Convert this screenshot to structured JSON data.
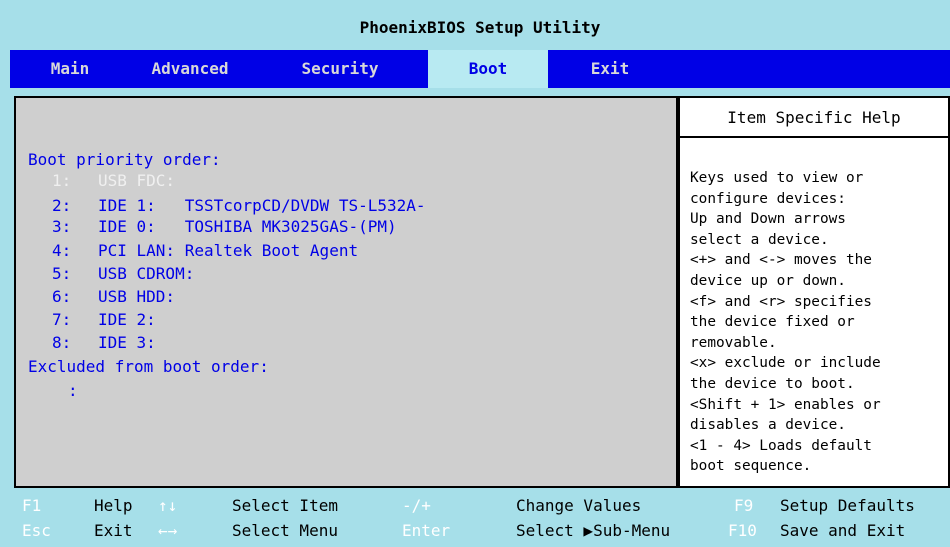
{
  "title": "PhoenixBIOS Setup Utility",
  "menu": [
    {
      "label": "Main",
      "active": false
    },
    {
      "label": "Advanced",
      "active": false
    },
    {
      "label": "Security",
      "active": false
    },
    {
      "label": "Boot",
      "active": true
    },
    {
      "label": "Exit",
      "active": false
    }
  ],
  "boot": {
    "priority_heading": "Boot priority order:",
    "entries": [
      {
        "num": "1:",
        "text": "USB FDC:",
        "dimmed": true
      },
      {
        "num": "2:",
        "text": "IDE 1:   TSSTcorpCD/DVDW TS-L532A-",
        "dimmed": false
      },
      {
        "num": "3:",
        "text": "IDE 0:   TOSHIBA MK3025GAS-(PM)",
        "dimmed": false
      },
      {
        "num": "4:",
        "text": "PCI LAN: Realtek Boot Agent",
        "dimmed": false
      },
      {
        "num": "5:",
        "text": "USB CDROM:",
        "dimmed": false
      },
      {
        "num": "6:",
        "text": "USB HDD:",
        "dimmed": false
      },
      {
        "num": "7:",
        "text": "IDE 2:",
        "dimmed": false
      },
      {
        "num": "8:",
        "text": "IDE 3:",
        "dimmed": false
      }
    ],
    "excluded_heading": "Excluded from boot order:",
    "excluded_entry": ":"
  },
  "help": {
    "title": "Item Specific Help",
    "body": "Keys used to view or\nconfigure devices:\nUp and Down arrows\nselect a device.\n<+> and <-> moves the\ndevice up or down.\n<f> and <r> specifies\nthe device fixed or\nremovable.\n<x> exclude or include\nthe device to boot.\n<Shift + 1> enables or\ndisables a device.\n<1 - 4> Loads default\nboot sequence."
  },
  "footer": {
    "row1": [
      {
        "key": "F1",
        "label": "Help"
      },
      {
        "key": "↑↓",
        "label": "Select Item"
      },
      {
        "key": "-/+",
        "label": "Change Values"
      },
      {
        "key": "F9",
        "label": "Setup Defaults"
      }
    ],
    "row2": [
      {
        "key": "Esc",
        "label": "Exit"
      },
      {
        "key": "←→",
        "label": "Select Menu"
      },
      {
        "key": "Enter",
        "label": "Select ▶Sub-Menu"
      },
      {
        "key": "F10",
        "label": "Save and Exit"
      }
    ]
  },
  "colors": {
    "background": "#a6dfe9",
    "menu_bar": "#0000e6",
    "main_panel": "#cfcfcf",
    "text_blue": "#0000e6"
  }
}
